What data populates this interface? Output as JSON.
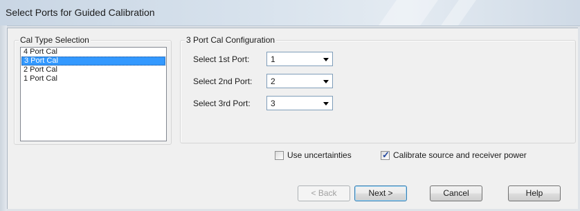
{
  "window": {
    "title": "Select Ports for Guided Calibration"
  },
  "cal_type": {
    "group_label": "Cal Type Selection",
    "items": [
      {
        "label": "4 Port Cal",
        "selected": false
      },
      {
        "label": "3 Port Cal",
        "selected": true
      },
      {
        "label": "2 Port Cal",
        "selected": false
      },
      {
        "label": "1 Port Cal",
        "selected": false
      }
    ]
  },
  "config": {
    "group_label": "3 Port Cal Configuration",
    "rows": [
      {
        "label": "Select 1st Port:",
        "value": "1"
      },
      {
        "label": "Select 2nd Port:",
        "value": "2"
      },
      {
        "label": "Select 3rd Port:",
        "value": "3"
      }
    ]
  },
  "options": {
    "use_uncertainties": {
      "label": "Use uncertainties",
      "checked": false
    },
    "calibrate_power": {
      "label": "Calibrate source and receiver power",
      "checked": true
    }
  },
  "buttons": {
    "back": "< Back",
    "next": "Next >",
    "cancel": "Cancel",
    "help": "Help"
  },
  "colors": {
    "selection": "#3399ff",
    "dialog_bg": "#f0f0f0",
    "check_tick": "#21469d"
  }
}
